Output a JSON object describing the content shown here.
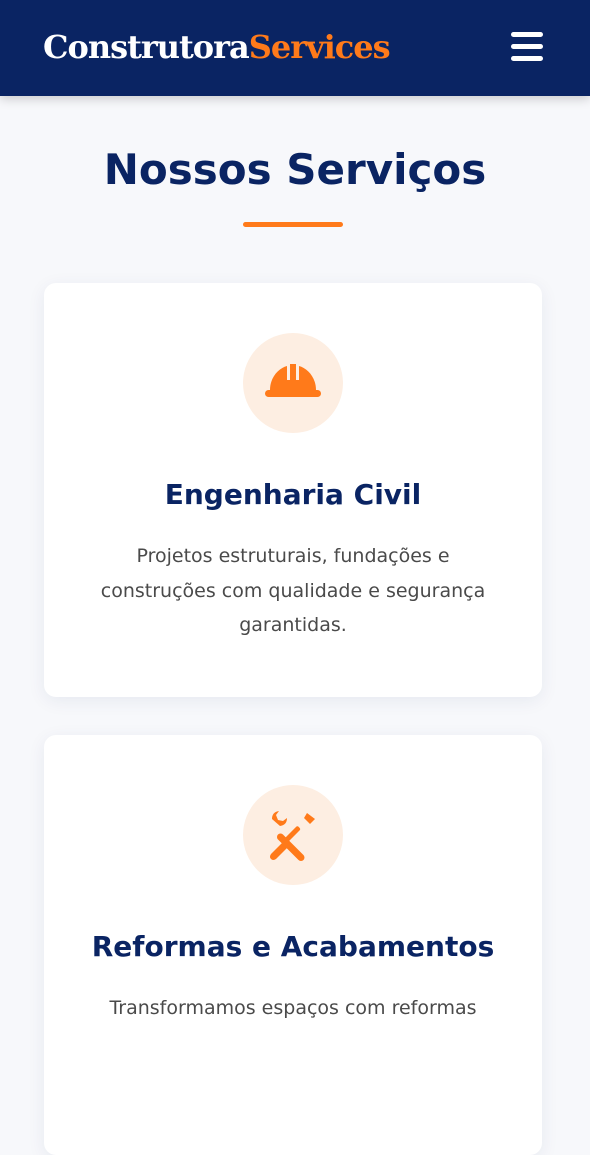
{
  "header": {
    "brand_main": "Construtora",
    "brand_accent": "Services",
    "menu_icon": "hamburger-menu-icon",
    "background_color": "#0a2463",
    "accent_color": "#ff7a1a"
  },
  "section": {
    "title": "Nossos Serviços"
  },
  "services": [
    {
      "icon": "hard-hat-icon",
      "title": "Engenharia Civil",
      "description": "Projetos estruturais, fundações e construções com qualidade e segurança garantidas."
    },
    {
      "icon": "tools-icon",
      "title": "Reformas e Acabamentos",
      "description": "Transformamos espaços com reformas"
    }
  ]
}
